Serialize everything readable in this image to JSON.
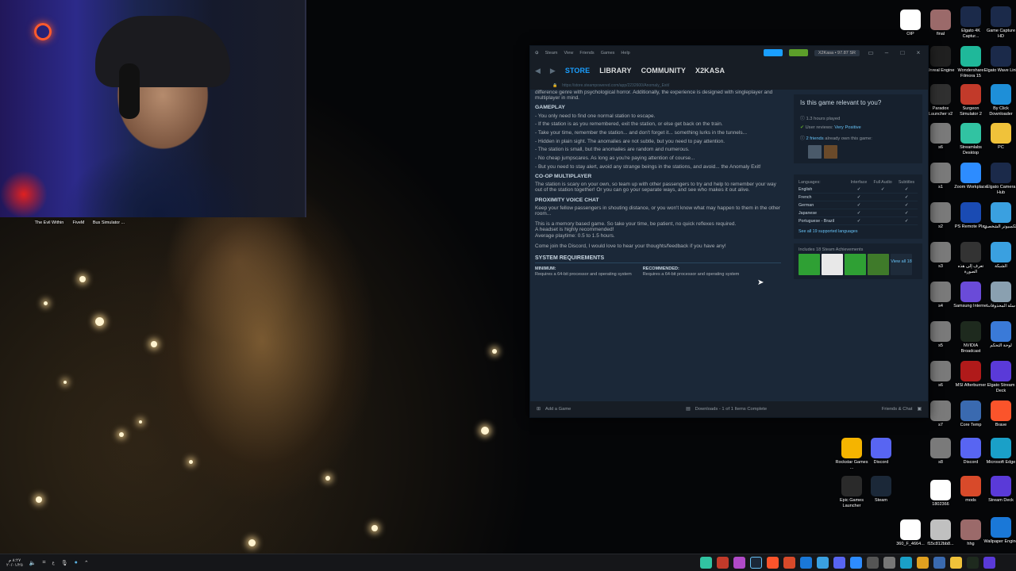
{
  "desktop": {
    "webcam_overlay_label": "Streamer webcam",
    "left_icons": [
      {
        "label": "The Evil Within",
        "icon": "game-icon",
        "color": "#3a2a24"
      },
      {
        "label": "FiveM",
        "icon": "game-icon",
        "color": "#f07b1c"
      },
      {
        "label": "Bus Simulator ...",
        "icon": "game-icon",
        "color": "#2b3f66"
      }
    ],
    "right_icons": [
      {
        "label": "OIP",
        "icon": "image-icon",
        "color": "#ffffff"
      },
      {
        "label": "final",
        "icon": "image-icon",
        "color": "#9b6a6a"
      },
      {
        "label": "Elgato 4K Captur...",
        "icon": "elgato-icon",
        "color": "#1b2a4a"
      },
      {
        "label": "Game Capture HD",
        "icon": "elgato-icon",
        "color": "#1b2a4a"
      },
      {
        "label": "Unreal Engine",
        "icon": "unreal-icon",
        "color": "#202020"
      },
      {
        "label": "Wondershare Filmora 15",
        "icon": "filmora-icon",
        "color": "#1fb89a"
      },
      {
        "label": "Elgato Wave Link",
        "icon": "elgato-icon",
        "color": "#1b2a4a"
      },
      {
        "label": "Paradox Launcher v2",
        "icon": "paradox-icon",
        "color": "#303030"
      },
      {
        "label": "Surgeon Simulator 2",
        "icon": "game-icon",
        "color": "#c23a2a"
      },
      {
        "label": "By Click Downloader",
        "icon": "download-icon",
        "color": "#1e8fd8"
      },
      {
        "label": "s6",
        "icon": "image-icon",
        "color": "#7a7a7a"
      },
      {
        "label": "Streamlabs Desktop",
        "icon": "streamlabs-icon",
        "color": "#31c3a2"
      },
      {
        "label": "PC",
        "icon": "folder-icon",
        "color": "#f0c23a"
      },
      {
        "label": "s1",
        "icon": "image-icon",
        "color": "#7a7a7a"
      },
      {
        "label": "Zoom Workplace",
        "icon": "zoom-icon",
        "color": "#2d8cff"
      },
      {
        "label": "Elgato Camera Hub",
        "icon": "elgato-icon",
        "color": "#1b2a4a"
      },
      {
        "label": "s2",
        "icon": "image-icon",
        "color": "#7a7a7a"
      },
      {
        "label": "PS Remote Play",
        "icon": "playstation-icon",
        "color": "#1a4bb3"
      },
      {
        "label": "الكمبيوتر الشخصي",
        "icon": "folder-icon",
        "color": "#3aa0e0"
      },
      {
        "label": "s3",
        "icon": "image-icon",
        "color": "#7a7a7a"
      },
      {
        "label": "تعرف إلى هذه الصورة",
        "icon": "info-icon",
        "color": "#333333"
      },
      {
        "label": "الشبكة",
        "icon": "network-icon",
        "color": "#3aa0e0"
      },
      {
        "label": "s4",
        "icon": "image-icon",
        "color": "#7a7a7a"
      },
      {
        "label": "Samsung Internet",
        "icon": "samsung-icon",
        "color": "#6a4bd8"
      },
      {
        "label": "سلة المحذوفات",
        "icon": "recycle-bin-icon",
        "color": "#8aa0b0"
      },
      {
        "label": "s5",
        "icon": "image-icon",
        "color": "#7a7a7a"
      },
      {
        "label": "NVIDIA Broadcast",
        "icon": "nvidia-icon",
        "color": "#1e2a1e"
      },
      {
        "label": "لوحة التحكم",
        "icon": "control-panel-icon",
        "color": "#3a7ad8"
      },
      {
        "label": "s6",
        "icon": "image-icon",
        "color": "#7a7a7a"
      },
      {
        "label": "MSI Afterburner",
        "icon": "msi-icon",
        "color": "#b01a1a"
      },
      {
        "label": "Elgato Stream Deck",
        "icon": "elgato-icon",
        "color": "#5a3ad8"
      },
      {
        "label": "s7",
        "icon": "image-icon",
        "color": "#7a7a7a"
      },
      {
        "label": "Core Temp",
        "icon": "thermometer-icon",
        "color": "#3a6ab0"
      },
      {
        "label": "Brave",
        "icon": "brave-icon",
        "color": "#fb542b"
      },
      {
        "label": "Rockstar Games ...",
        "icon": "rockstar-icon",
        "color": "#f5b400"
      },
      {
        "label": "Discord",
        "icon": "discord-icon",
        "color": "#5865f2"
      },
      {
        "label": "s8",
        "icon": "image-icon",
        "color": "#7a7a7a"
      },
      {
        "label": "Discord",
        "icon": "discord-icon",
        "color": "#5865f2"
      },
      {
        "label": "Microsoft Edge",
        "icon": "edge-icon",
        "color": "#1aa0c8"
      },
      {
        "label": "Epic Games Launcher",
        "icon": "epic-icon",
        "color": "#2a2a2a"
      },
      {
        "label": "Steam",
        "icon": "steam-icon",
        "color": "#1b2838"
      },
      {
        "label": "1802366",
        "icon": "image-icon",
        "color": "#ffffff"
      },
      {
        "label": "mods",
        "icon": "folder-icon",
        "color": "#d84a2a"
      },
      {
        "label": "Stream Deck",
        "icon": "elgato-icon",
        "color": "#5a3ad8"
      },
      {
        "label": "360_F_4664...",
        "icon": "image-icon",
        "color": "#ffffff"
      },
      {
        "label": "f15c812bb8...",
        "icon": "image-icon",
        "color": "#c0c0c0"
      },
      {
        "label": "hhg",
        "icon": "image-icon",
        "color": "#9b6a6a"
      },
      {
        "label": "Wallpaper Engine",
        "icon": "wallpaper-engine-icon",
        "color": "#1a78d8"
      }
    ]
  },
  "steam": {
    "titlebar": {
      "menu": [
        "Steam",
        "View",
        "Friends",
        "Games",
        "Help"
      ],
      "account": "X2Kasa • 97.87 SR",
      "accent_blue": "#1a9fff",
      "accent_green": "#5c9e2a"
    },
    "nav": {
      "tabs": [
        "STORE",
        "LIBRARY",
        "COMMUNITY",
        "X2KASA"
      ],
      "url": "https://store.steampowered.com/app/2232600/Anomaly_Exit/"
    },
    "description": {
      "intro": "difference genre with psychological horror. Additionally, the experience is designed with singleplayer and multiplayer in mind.",
      "gameplay_heading": "GAMEPLAY",
      "gameplay_lines": [
        "- You only need to find one normal station to escape.",
        "- If the station is as you remembered, exit the station, or else get back on the train.",
        "- Take your time, remember the station... and don't forget it... something lurks in the tunnels...",
        "- Hidden in plain sight. The anomalies are not subtle, but you need to pay attention.",
        "- The station is small, but the anomalies are random and numerous.",
        "- No cheap jumpscares. As long as you're paying attention of course...",
        "- But you need to stay alert, avoid any strange beings in the stations, and avoid... the Anomaly Exit!"
      ],
      "coop_heading": "CO-OP MULTIPLAYER",
      "coop_text": "The station is scary on your own, so team up with other passengers to try and help to remember your way out of the station together! Or you can go your separate ways, and see who makes it out alive.",
      "voice_heading": "PROXIMITY VOICE CHAT",
      "voice_text": "Keep your fellow passengers in shouting distance, or you won't know what may happen to them in the other room...",
      "memory_lines": [
        "This is a memory based game. So take your time, be patient, no quick reflexes required.",
        "A headset is highly recommended!",
        "Average playtime: 0.5 to 1.5 hours."
      ],
      "discord_text": "Come join the Discord, I would love to hear your thoughts/feedback if you have any!",
      "sysreq_heading": "SYSTEM REQUIREMENTS",
      "minimum_label": "MINIMUM:",
      "minimum_text": "Requires a 64-bit processor and operating system",
      "recommended_label": "RECOMMENDED:",
      "recommended_text": "Requires a 64-bit processor and operating system"
    },
    "relevance": {
      "title": "Is this game relevant to you?",
      "hours_played": "1.3 hours played",
      "reviews_label": "User reviews:",
      "reviews_value": "Very Positive",
      "friends_link": "2 friends",
      "friends_suffix": "already own this game:"
    },
    "languages": {
      "label": "Languages:",
      "columns": [
        "Interface",
        "Full Audio",
        "Subtitles"
      ],
      "rows": [
        {
          "name": "English",
          "interface": "✓",
          "audio": "✓",
          "subtitles": "✓"
        },
        {
          "name": "French",
          "interface": "✓",
          "audio": "",
          "subtitles": "✓"
        },
        {
          "name": "German",
          "interface": "✓",
          "audio": "",
          "subtitles": "✓"
        },
        {
          "name": "Japanese",
          "interface": "✓",
          "audio": "",
          "subtitles": "✓"
        },
        {
          "name": "Portuguese - Brazil",
          "interface": "✓",
          "audio": "",
          "subtitles": "✓"
        }
      ],
      "see_all": "See all 19 supported languages"
    },
    "achievements": {
      "title": "Includes 18 Steam Achievements",
      "view_all": "View all 18",
      "tile_color": "#2fa034"
    },
    "bottom": {
      "add_game": "Add a Game",
      "downloads": "Downloads - 1 of 1 Items Complete",
      "friends_chat": "Friends & Chat"
    }
  },
  "taskbar": {
    "clock_time": "٨:٢٧ م",
    "clock_date": "٢٠/٠١/٢٥",
    "lang": "ع"
  }
}
